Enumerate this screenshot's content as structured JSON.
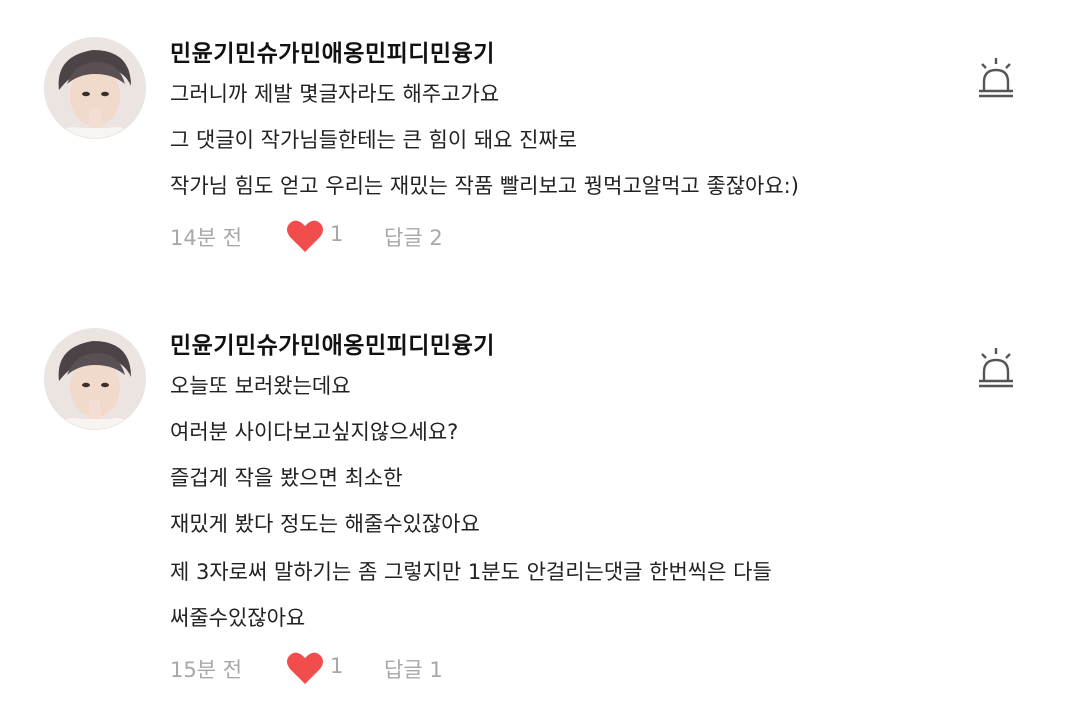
{
  "colors": {
    "heart": "#f24d4d",
    "meta_text": "#a8a8a8",
    "author_text": "#111111"
  },
  "comments": [
    {
      "author": "민윤기민슈가민애옹민피디민융기",
      "lines": [
        "그러니까 제발 몇글자라도 해주고가요",
        "그 댓글이 작가님들한테는 큰 힘이 돼요 진짜로",
        "작가님 힘도 얻고 우리는 재밌는 작품 빨리보고  꿩먹고알먹고 좋잖아요:)"
      ],
      "time": "14분 전",
      "likes": "1",
      "reply": "답글 2",
      "icons": {
        "like": "heart-icon",
        "report": "siren-icon"
      }
    },
    {
      "author": "민윤기민슈가민애옹민피디민융기",
      "lines": [
        "오늘또 보러왔는데요",
        "여러분 사이다보고싶지않으세요?",
        "즐겁게 작을 봤으면 최소한",
        "재밌게 봤다 정도는 해줄수있잖아요",
        "제 3자로써 말하기는 좀 그렇지만 1분도 안걸리는댓글 한번씩은 다들",
        "써줄수있잖아요"
      ],
      "time": "15분 전",
      "likes": "1",
      "reply": "답글 1",
      "icons": {
        "like": "heart-icon",
        "report": "siren-icon"
      }
    }
  ]
}
